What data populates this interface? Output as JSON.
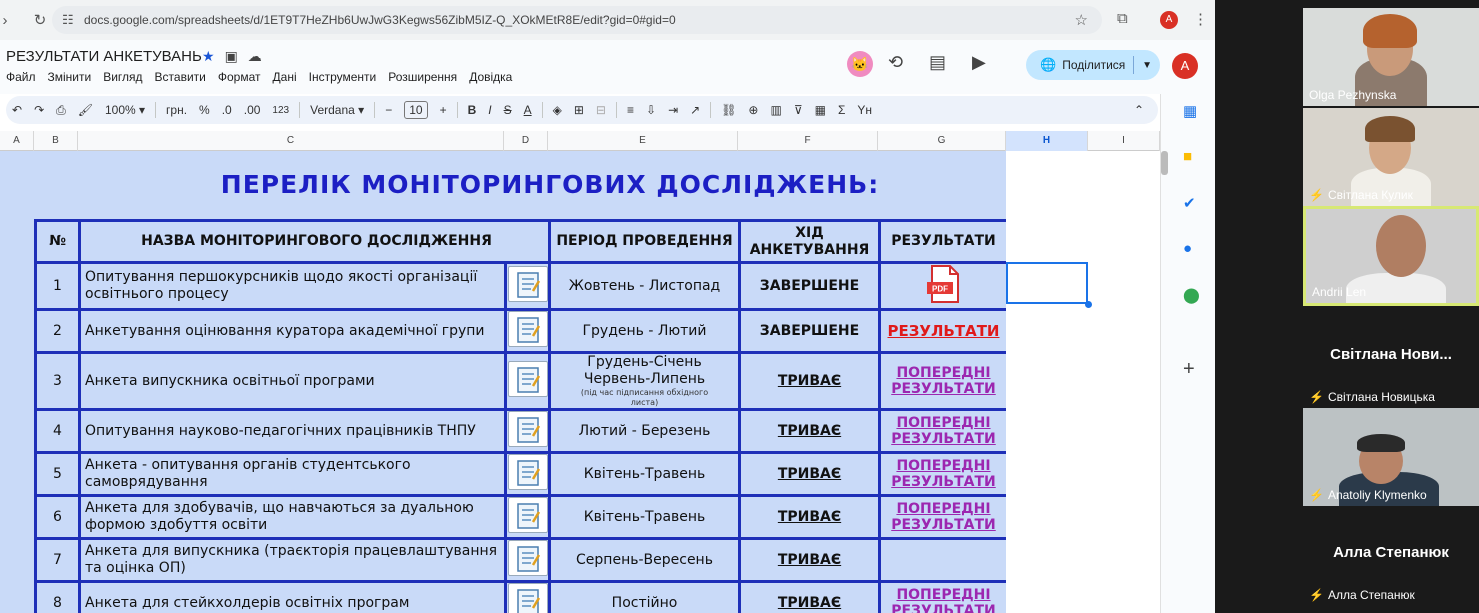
{
  "browser": {
    "url": "docs.google.com/spreadsheets/d/1ET9T7HeZHb6UwJwG3Kegws56ZibM5IZ-Q_XOkMEtR8E/edit?gid=0#gid=0",
    "profile_initial": "A"
  },
  "doc": {
    "title": "РЕЗУЛЬТАТИ АНКЕТУВАНЬ",
    "menu": [
      "Файл",
      "Змінити",
      "Вигляд",
      "Вставити",
      "Формат",
      "Дані",
      "Інструменти",
      "Розширення",
      "Довідка"
    ],
    "share_label": "Поділитися",
    "avatar_initial": "A"
  },
  "toolbar": {
    "zoom": "100%",
    "currency": "грн.",
    "percent": "%",
    "dec_less": ".0",
    "dec_more": ".00",
    "number_format": "123",
    "font": "Verdana",
    "font_size": "10"
  },
  "columns": [
    "A",
    "B",
    "C",
    "D",
    "E",
    "F",
    "G",
    "H",
    "I"
  ],
  "sheet": {
    "heading": "ПЕРЕЛІК МОНІТОРИНГОВИХ ДОСЛІДЖЕНЬ:",
    "headers": {
      "num": "№",
      "name": "НАЗВА МОНІТОРИНГОВОГО ДОСЛІДЖЕННЯ",
      "period": "ПЕРІОД ПРОВЕДЕННЯ",
      "status": "ХІД АНКЕТУВАННЯ",
      "results": "РЕЗУЛЬТАТИ"
    },
    "rows": [
      {
        "num": "1",
        "name": "Опитування першокурсників щодо якості організації освітнього процесу",
        "period": "Жовтень - Листопад",
        "period_note": "",
        "status": "ЗАВЕРШЕНЕ",
        "result": "PDF"
      },
      {
        "num": "2",
        "name": "Анкетування оцінювання куратора академічної групи",
        "period": "Грудень - Лютий",
        "period_note": "",
        "status": "ЗАВЕРШЕНЕ",
        "result": "РЕЗУЛЬТАТИ"
      },
      {
        "num": "3",
        "name": "Анкета випускника освітньої програми",
        "period": "Грудень-Січень Червень-Липень",
        "period_note": "(під час підписання обхідного листа)",
        "status": "ТРИВАЄ",
        "result": "ПОПЕРЕДНІ РЕЗУЛЬТАТИ"
      },
      {
        "num": "4",
        "name": "Опитування науково-педагогічних працівників ТНПУ",
        "period": "Лютий - Березень",
        "period_note": "",
        "status": "ТРИВАЄ",
        "result": "ПОПЕРЕДНІ РЕЗУЛЬТАТИ"
      },
      {
        "num": "5",
        "name": "Анкета - опитування органів студентського самоврядування",
        "period": "Квітень-Травень",
        "period_note": "",
        "status": "ТРИВАЄ",
        "result": "ПОПЕРЕДНІ РЕЗУЛЬТАТИ"
      },
      {
        "num": "6",
        "name": "Анкета для здобувачів, що навчаються за дуальною формою здобуття освіти",
        "period": "Квітень-Травень",
        "period_note": "",
        "status": "ТРИВАЄ",
        "result": "ПОПЕРЕДНІ РЕЗУЛЬТАТИ"
      },
      {
        "num": "7",
        "name": "Анкета для випускника (траєкторія працевлаштування та оцінка ОП)",
        "period": "Серпень-Вересень",
        "period_note": "",
        "status": "ТРИВАЄ",
        "result": ""
      },
      {
        "num": "8",
        "name": "Анкета для стейкхолдерів освітніх програм",
        "period": "Постійно",
        "period_note": "",
        "status": "ТРИВАЄ",
        "result": "ПОПЕРЕДНІ РЕЗУЛЬТАТИ"
      }
    ]
  },
  "call": {
    "participants": [
      {
        "name": "Olga Pezhynska",
        "muted": false,
        "video": true
      },
      {
        "name": "Світлана Кулик",
        "muted": true,
        "video": true
      },
      {
        "name": "Andrii Len",
        "muted": false,
        "video": true,
        "active": true
      },
      {
        "name": "Світлана Нови...",
        "label": "Світлана Новицька",
        "muted": true,
        "video": false
      },
      {
        "name": "Anatoliy Klymenko",
        "muted": true,
        "video": true
      },
      {
        "name": "Алла Степанюк",
        "label": "Алла Степанюк",
        "muted": true,
        "video": false
      }
    ]
  },
  "colors": {
    "heading": "#1c1fc4",
    "done": "#e01a1a",
    "ongoing": "#1155cc",
    "prelim": "#9c27b0",
    "sheet_bg": "#c9daf8"
  }
}
